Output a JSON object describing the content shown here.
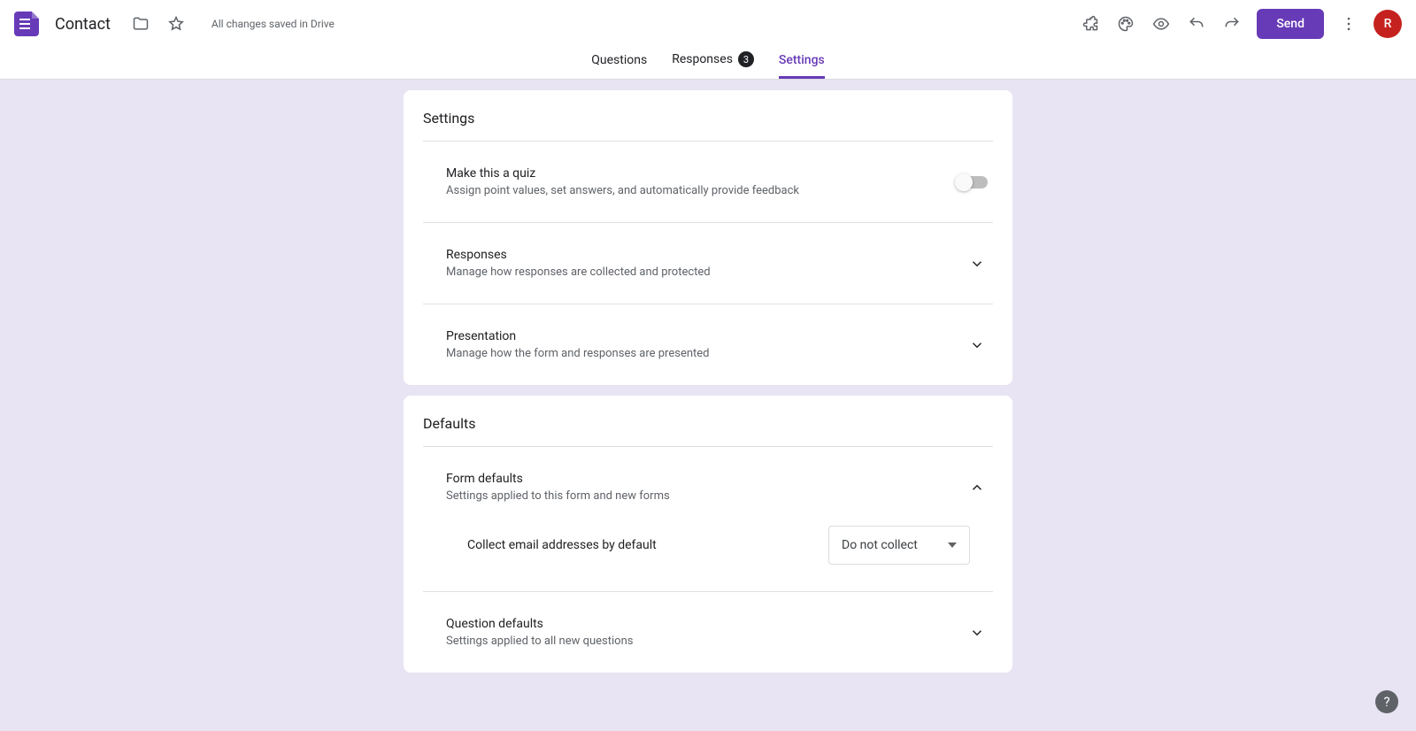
{
  "header": {
    "title": "Contact",
    "saved_status": "All changes saved in Drive",
    "send_label": "Send",
    "avatar_initial": "R"
  },
  "tabs": {
    "questions": "Questions",
    "responses": "Responses",
    "responses_count": "3",
    "settings": "Settings"
  },
  "settings_card": {
    "title": "Settings",
    "quiz": {
      "title": "Make this a quiz",
      "desc": "Assign point values, set answers, and automatically provide feedback",
      "enabled": false
    },
    "responses": {
      "title": "Responses",
      "desc": "Manage how responses are collected and protected"
    },
    "presentation": {
      "title": "Presentation",
      "desc": "Manage how the form and responses are presented"
    }
  },
  "defaults_card": {
    "title": "Defaults",
    "form_defaults": {
      "title": "Form defaults",
      "desc": "Settings applied to this form and new forms",
      "collect_email_label": "Collect email addresses by default",
      "collect_email_value": "Do not collect"
    },
    "question_defaults": {
      "title": "Question defaults",
      "desc": "Settings applied to all new questions"
    }
  }
}
